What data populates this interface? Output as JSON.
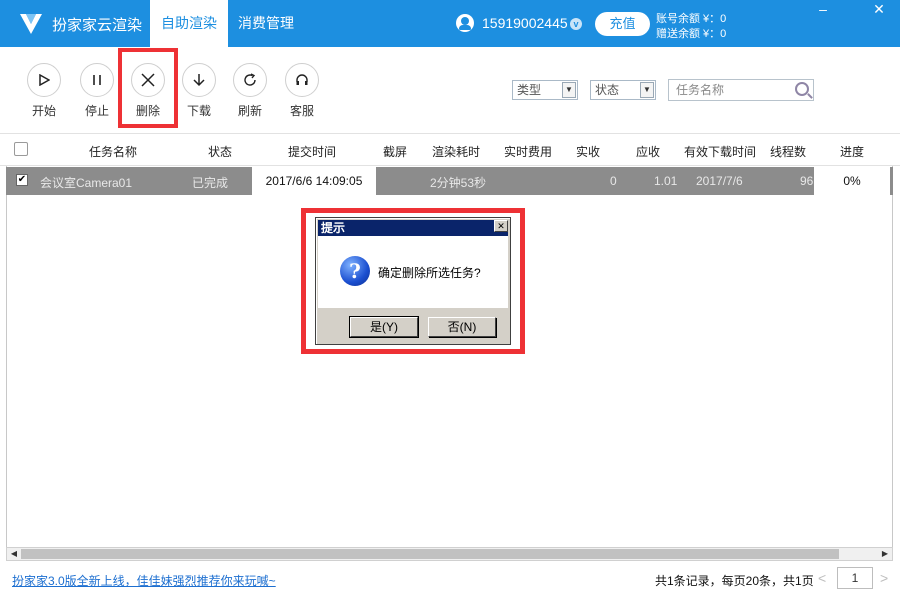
{
  "header": {
    "app_title": "扮家家云渲染",
    "tabs": [
      {
        "label": "自助渲染",
        "active": true
      },
      {
        "label": "消费管理",
        "active": false
      }
    ],
    "phone": "15919002445",
    "v_badge": "v",
    "recharge_label": "充值",
    "account_balance": "账号余额 ¥：0",
    "gift_balance": "赠送余额 ¥：0",
    "window_controls": {
      "minimize": "‒",
      "close": "✕"
    },
    "accent_color": "#1d8fe0"
  },
  "toolbar": {
    "buttons": [
      {
        "label": "开始",
        "icon": "play-icon"
      },
      {
        "label": "停止",
        "icon": "pause-icon"
      },
      {
        "label": "删除",
        "icon": "close-icon"
      },
      {
        "label": "下载",
        "icon": "download-arrow-icon"
      },
      {
        "label": "刷新",
        "icon": "refresh-icon"
      },
      {
        "label": "客服",
        "icon": "headset-icon"
      }
    ],
    "filters": {
      "type_value": "类型",
      "status_value": "状态",
      "search_placeholder": "任务名称"
    }
  },
  "table": {
    "columns": [
      "任务名称",
      "状态",
      "提交时间",
      "截屏",
      "渲染耗时",
      "实时费用",
      "实收",
      "应收",
      "有效下载时间",
      "线程数",
      "进度"
    ],
    "rows": [
      {
        "checked": true,
        "name": "会议室Camera01",
        "status": "已完成",
        "submit_time": "2017/6/6 14:09:05",
        "screenshot": "",
        "render_time": "2分钟53秒",
        "realtime_fee": "",
        "received": "0",
        "receivable": "1.01",
        "download_time": "2017/7/6",
        "threads": "96",
        "progress": "0%"
      }
    ]
  },
  "footer": {
    "announcement": "扮家家3.0版全新上线，佳佳妹强烈推荐你来玩喊~",
    "records": "共1条记录，每页20条，共1页",
    "page": "1"
  },
  "dialog": {
    "title": "提示",
    "message": "确定删除所选任务?",
    "yes_label": "是(Y)",
    "no_label": "否(N)",
    "icon": "question-icon"
  }
}
